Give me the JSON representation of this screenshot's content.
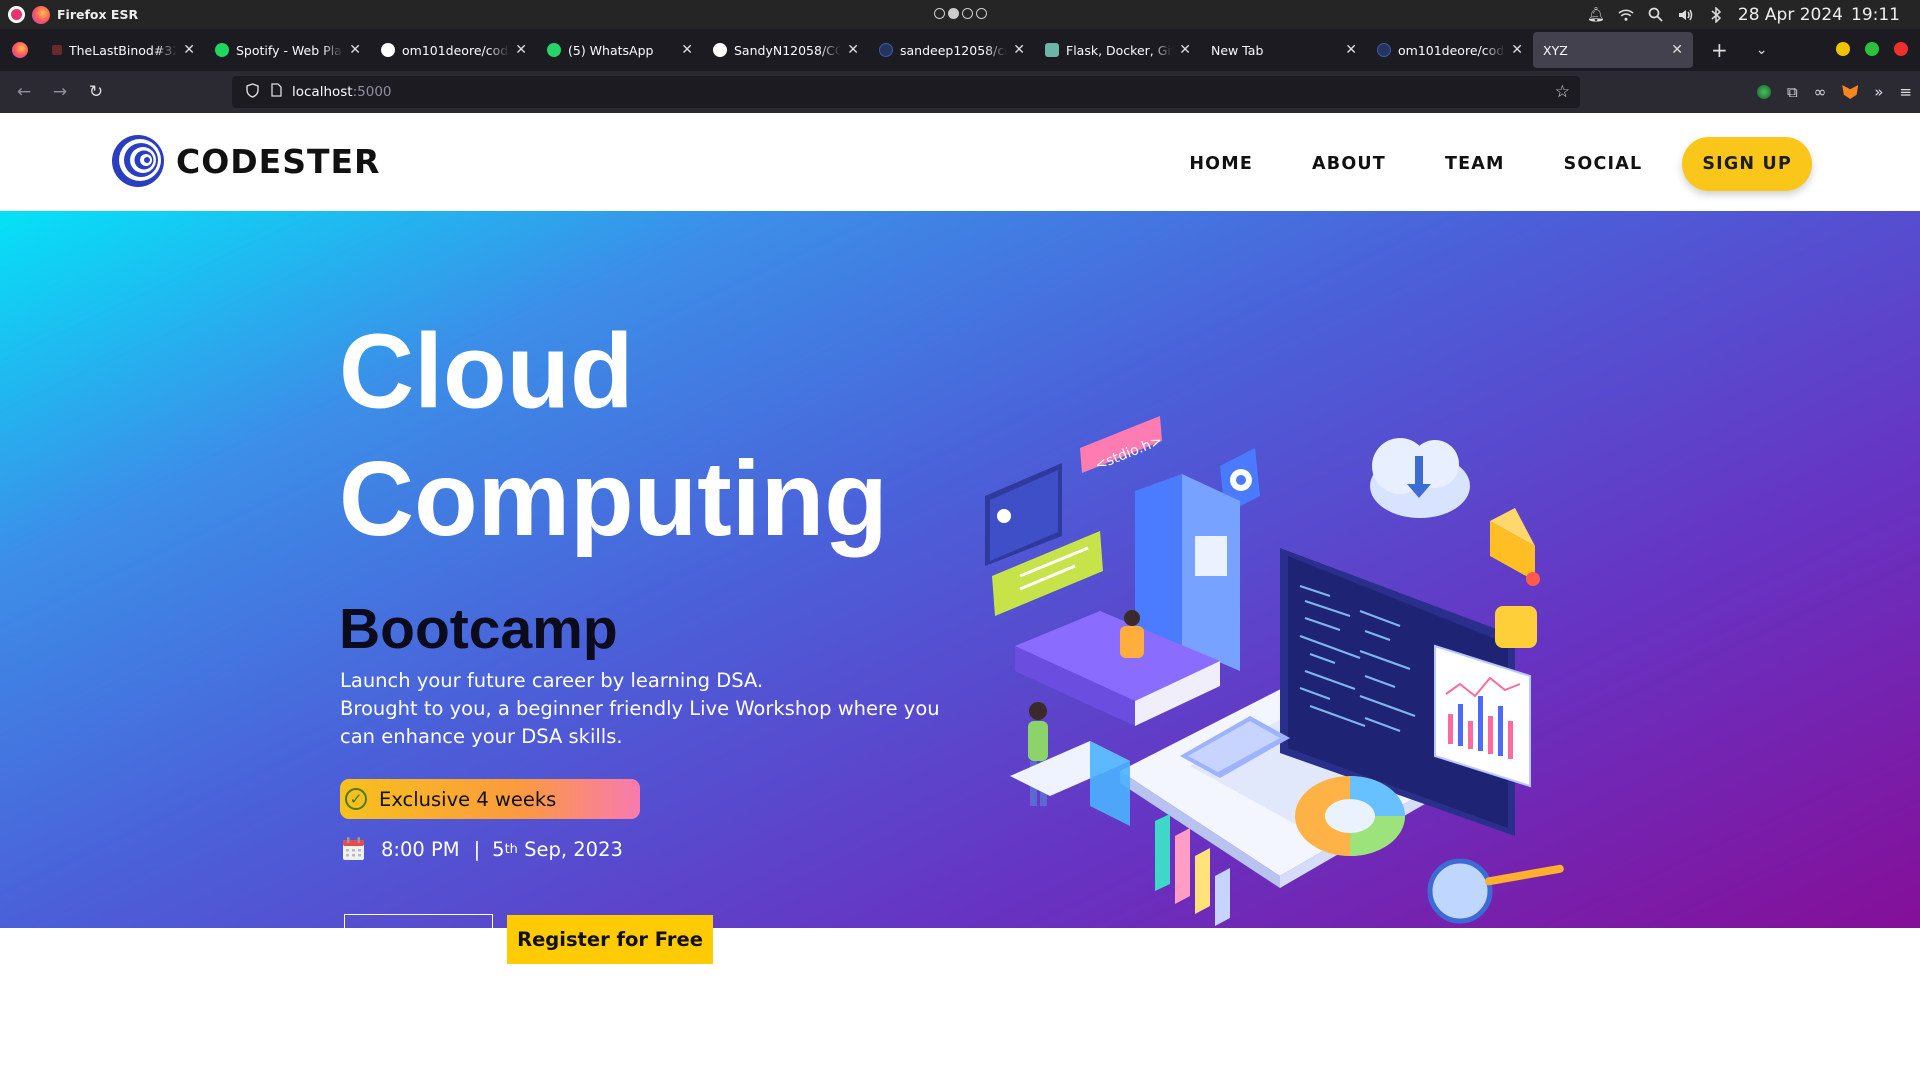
{
  "os": {
    "app_name": "Firefox ESR",
    "date": "28 Apr 2024",
    "time": "19:11"
  },
  "tabs": [
    {
      "title": "TheLastBinod#3254",
      "favicon_color": "#8a3a3a"
    },
    {
      "title": "Spotify - Web Player",
      "favicon_color": "#1ed760"
    },
    {
      "title": "om101deore/code",
      "favicon_color": "#ffffff"
    },
    {
      "title": "(5) WhatsApp",
      "favicon_color": "#25d366"
    },
    {
      "title": "SandyN12058/CC",
      "favicon_color": "#ffffff"
    },
    {
      "title": "sandeep12058/co",
      "favicon_color": "#3b5ba9"
    },
    {
      "title": "Flask, Docker, GitHub",
      "favicon_color": "#6bb6a6"
    },
    {
      "title": "New Tab",
      "favicon_color": ""
    },
    {
      "title": "om101deore/code",
      "favicon_color": "#3b5ba9"
    },
    {
      "title": "XYZ",
      "favicon_color": ""
    }
  ],
  "url": {
    "host": "localhost",
    "port": ":5000"
  },
  "site": {
    "brand": "CODESTER",
    "nav": [
      "HOME",
      "ABOUT",
      "TEAM",
      "SOCIAL"
    ],
    "signup": "SIGN UP",
    "hero": {
      "title_line1": "Cloud",
      "title_line2": "Computing",
      "subtitle": "Bootcamp",
      "desc_line1": "Launch your future career by learning DSA.",
      "desc_line2": "Brought to you, a beginner friendly Live Workshop where you can enhance your DSA skills.",
      "badge": "Exclusive 4 weeks",
      "time": "8:00 PM",
      "separator": "|",
      "date_day": "5",
      "date_suffix": "th",
      "date_rest": " Sep, 2023",
      "register": "Register for Free",
      "illus_tag": "<stdio.h>"
    }
  },
  "colors": {
    "accent_yellow": "#fbc61a",
    "hero_gradient_start": "#05e2f7",
    "hero_gradient_end": "#850f98"
  }
}
